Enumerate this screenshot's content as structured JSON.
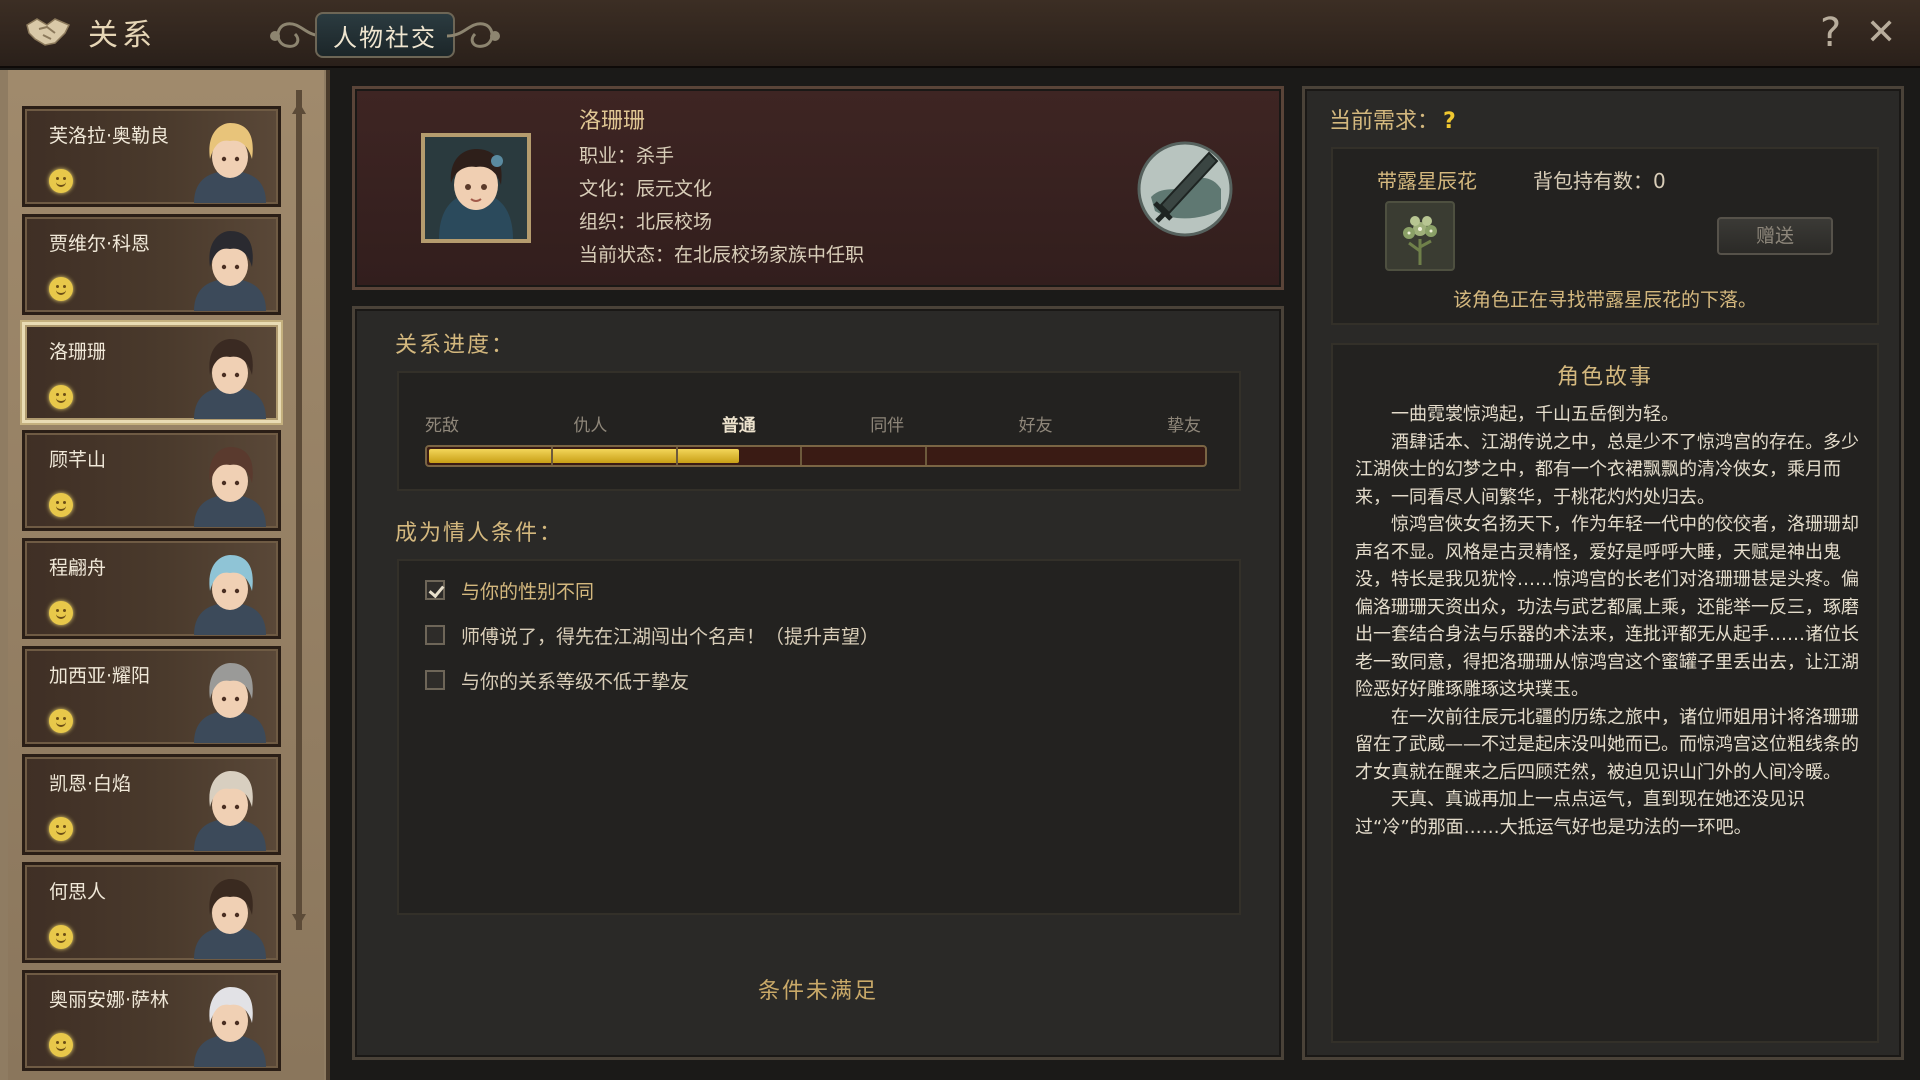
{
  "header": {
    "title": "关系",
    "active_tab": "人物社交",
    "help_label": "?",
    "close_label": "✕"
  },
  "sidebar": {
    "characters": [
      {
        "name": "芙洛拉·奥勒良",
        "mood": "happy",
        "active": false
      },
      {
        "name": "贾维尔·科恩",
        "mood": "happy",
        "active": false
      },
      {
        "name": "洛珊珊",
        "mood": "happy",
        "active": true
      },
      {
        "name": "顾芊山",
        "mood": "happy",
        "active": false
      },
      {
        "name": "程翩舟",
        "mood": "happy",
        "active": false
      },
      {
        "name": "加西亚·耀阳",
        "mood": "happy",
        "active": false
      },
      {
        "name": "凯恩·白焰",
        "mood": "happy",
        "active": false
      },
      {
        "name": "何思人",
        "mood": "happy",
        "active": false
      },
      {
        "name": "奥丽安娜·萨林",
        "mood": "happy",
        "active": false
      }
    ]
  },
  "profile": {
    "name": "洛珊珊",
    "job": "职业：杀手",
    "culture": "文化：辰元文化",
    "org": "组织：北辰校场",
    "status": "当前状态：在北辰校场家族中任职",
    "emblem_icon": "sword-emblem-icon"
  },
  "relation": {
    "title": "关系进度：",
    "levels": [
      "死敌",
      "仇人",
      "普通",
      "同伴",
      "好友",
      "挚友"
    ],
    "current_level": "普通",
    "progress": 0.4
  },
  "conditions": {
    "title": "成为情人条件：",
    "items": [
      {
        "text": "与你的性别不同",
        "met": true
      },
      {
        "text": "师傅说了，得先在江湖闯出个名声！（提升声望）",
        "met": false
      },
      {
        "text": "与你的关系等级不低于挚友",
        "met": false
      }
    ],
    "status": "条件未满足"
  },
  "need": {
    "title": "当前需求：",
    "unknown_mark": "?",
    "item_name": "带露星辰花",
    "inventory": "背包持有数：0",
    "gift_label": "赠送",
    "message": "该角色正在寻找带露星辰花的下落。"
  },
  "story": {
    "title": "角色故事",
    "paragraphs": [
      "一曲霓裳惊鸿起，千山五岳倒为轻。",
      "酒肆话本、江湖传说之中，总是少不了惊鸿宫的存在。多少江湖俠士的幻梦之中，都有一个衣裙飘飘的清冷俠女，乘月而来，一同看尽人间繁华，于桃花灼灼处归去。",
      "惊鸿宫俠女名扬天下，作为年轻一代中的佼佼者，洛珊珊却声名不显。风格是古灵精怪，爱好是呼呼大睡，天赋是神出鬼没，特长是我见犹怜……惊鸿宫的长老们对洛珊珊甚是头疼。偏偏洛珊珊天资出众，功法与武艺都属上乘，还能举一反三，琢磨出一套结合身法与乐器的术法来，连批评都无从起手……诸位长老一致同意，得把洛珊珊从惊鸿宫这个蜜罐子里丢出去，让江湖险恶好好雕琢雕琢这块璞玉。",
      "在一次前往辰元北疆的历练之旅中，诸位师姐用计将洛珊珊留在了武威——不过是起床没叫她而已。而惊鸿宫这位粗线条的才女真就在醒来之后四顾茫然，被迫见识山门外的人间冷暖。",
      "天真、真诚再加上一点点运气，直到现在她还没见识过“冷”的那面……大抵运气好也是功法的一环吧。"
    ]
  },
  "colors": {
    "accent_gold": "#d4b87e",
    "progress_fill": "#e8c52e",
    "mood_happy": "#e8c84a"
  }
}
